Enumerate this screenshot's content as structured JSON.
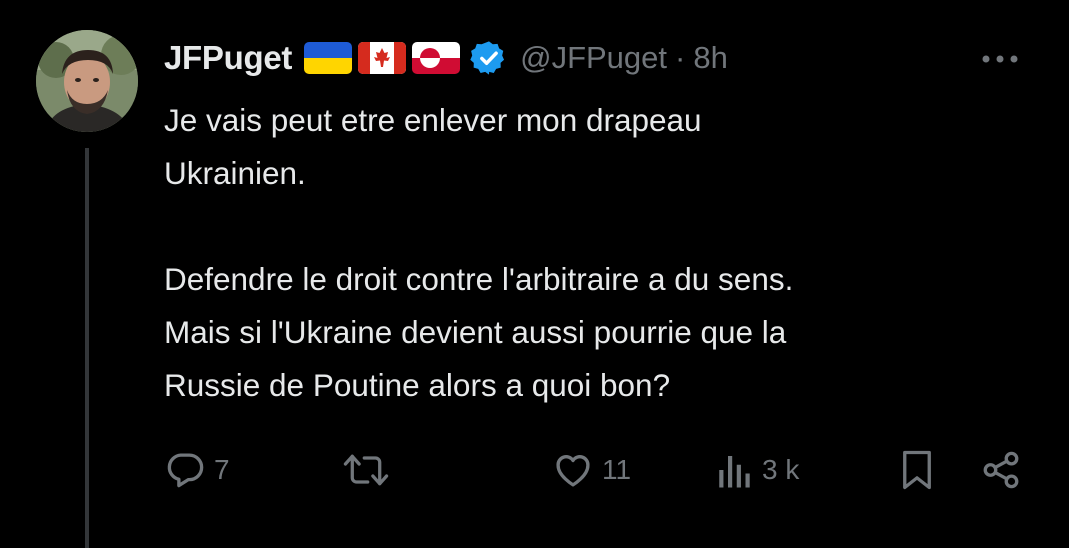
{
  "tweet": {
    "display_name": "JFPuget",
    "flags": [
      {
        "icon": "ukraine-flag-icon",
        "colors": [
          "#1e5bd6",
          "#ffd500"
        ]
      },
      {
        "icon": "canada-flag-icon",
        "colors": [
          "#d52b1e",
          "#ffffff"
        ]
      },
      {
        "icon": "greenland-flag-icon",
        "colors": [
          "#ffffff",
          "#d00c33"
        ]
      }
    ],
    "verified_icon": "verified-badge-icon",
    "verified_color": "#1d9bf0",
    "handle": "@JFPuget",
    "separator": "·",
    "time": "8h",
    "more_icon": "more-options-icon",
    "text_lines": [
      "Je vais peut etre enlever mon drapeau",
      "Ukrainien.",
      "",
      "Defendre le droit contre l'arbitraire a du sens.",
      "Mais si l'Ukraine devient aussi pourrie que la",
      "Russie de Poutine alors a quoi bon?"
    ]
  },
  "actions": {
    "reply": {
      "icon": "reply-icon",
      "count": "7"
    },
    "retweet": {
      "icon": "retweet-icon",
      "count": ""
    },
    "like": {
      "icon": "like-heart-icon",
      "count": "11"
    },
    "views": {
      "icon": "views-chart-icon",
      "count": "3 k"
    },
    "bookmark": {
      "icon": "bookmark-icon"
    },
    "share": {
      "icon": "share-icon"
    }
  },
  "colors": {
    "background": "#000000",
    "text": "#e7e9ea",
    "muted": "#71767b",
    "thread_line": "#333639"
  }
}
